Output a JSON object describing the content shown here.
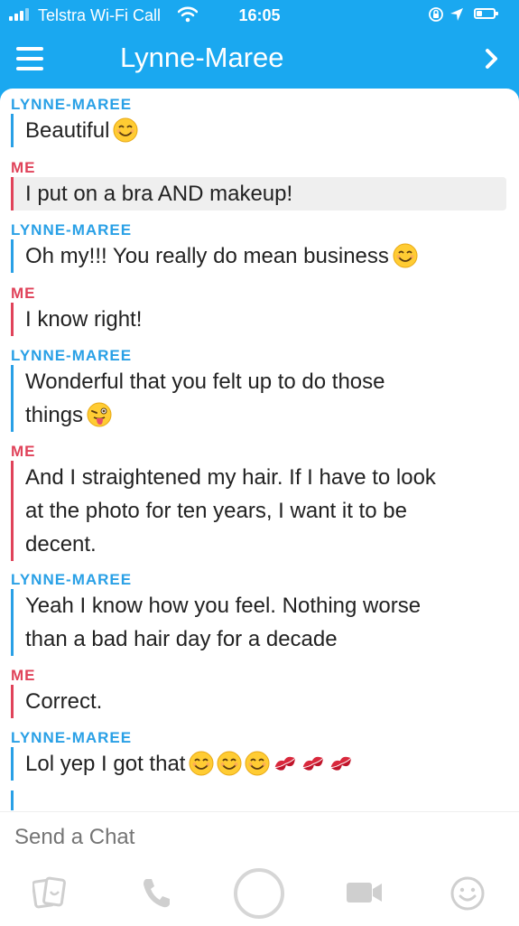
{
  "status_bar": {
    "carrier": "Telstra Wi-Fi Call",
    "time": "16:05",
    "icons": [
      "signal-bars-icon",
      "wifi-icon",
      "rotation-lock-icon",
      "location-arrow-icon",
      "battery-icon"
    ]
  },
  "header": {
    "title": "Lynne-Maree",
    "left_icon": "menu-icon",
    "right_icon": "chevron-right-icon"
  },
  "messages": [
    {
      "sender": "LYNNE-MAREE",
      "text": "Beautiful",
      "emojis": [
        "smiling-face-icon"
      ]
    },
    {
      "sender": "ME",
      "text": "I put on a bra AND makeup!",
      "saved": true
    },
    {
      "sender": "LYNNE-MAREE",
      "text": "Oh my!!! You really do mean business",
      "emojis": [
        "smiling-face-icon"
      ]
    },
    {
      "sender": "ME",
      "text": "I know right!"
    },
    {
      "sender": "LYNNE-MAREE",
      "line1": "Wonderful that you felt up to do those",
      "line2": "things",
      "emojis": [
        "winking-tongue-face-icon"
      ]
    },
    {
      "sender": "ME",
      "line1": "And I straightened my hair. If I have to look",
      "line2": "at the photo for ten years, I want it to be",
      "line3": "decent."
    },
    {
      "sender": "LYNNE-MAREE",
      "line1": "Yeah I know how you feel. Nothing worse",
      "line2": "than a bad hair day for a decade"
    },
    {
      "sender": "ME",
      "text": "Correct."
    },
    {
      "sender": "LYNNE-MAREE",
      "text": "Lol yep I got that",
      "emojis": [
        "smiling-face-icon",
        "smiling-face-icon",
        "smiling-face-icon",
        "kiss-mark-icon",
        "kiss-mark-icon",
        "kiss-mark-icon"
      ]
    }
  ],
  "composer": {
    "placeholder": "Send a Chat"
  },
  "bottom_bar": {
    "icons": [
      "memories-cards-icon",
      "phone-icon",
      "capture-button",
      "video-camera-icon",
      "smiley-icon"
    ]
  },
  "colors": {
    "brand_blue": "#1aa8f0",
    "friend_color": "#29a0e6",
    "me_color": "#e0435a",
    "saved_bg": "#efefef"
  }
}
